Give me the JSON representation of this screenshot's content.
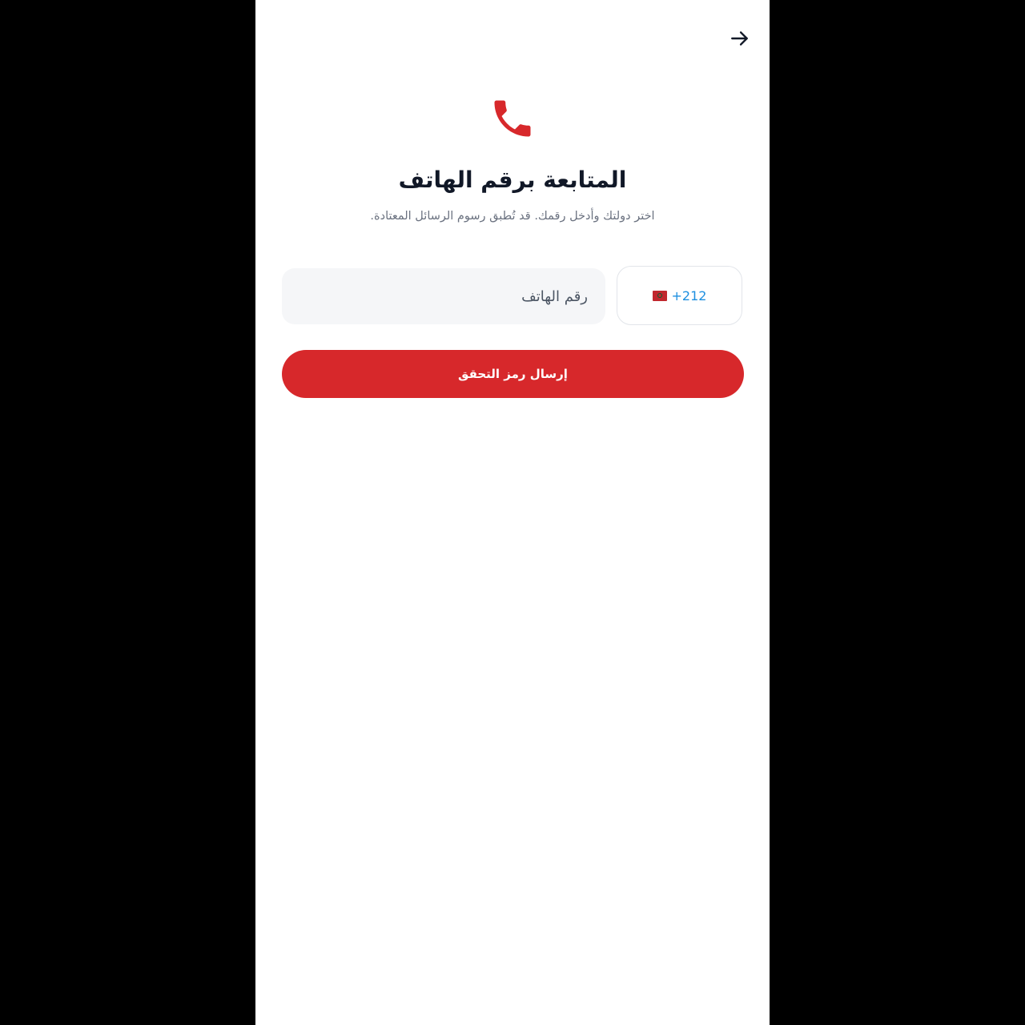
{
  "header": {
    "back_icon": "arrow-right-icon"
  },
  "hero": {
    "icon": "phone-icon",
    "icon_color": "#d7282b",
    "title": "المتابعة برقم الهاتف",
    "subtitle": "اختر دولتك وأدخل رقمك. قد تُطبق رسوم الرسائل المعتادة."
  },
  "form": {
    "country": {
      "flag_icon": "morocco-flag-icon",
      "dial_code": "+212"
    },
    "phone": {
      "value": "",
      "placeholder": "رقم الهاتف"
    },
    "submit_label": "إرسال رمز التحقق"
  },
  "colors": {
    "accent": "#d7282b",
    "dial_code": "#1d8fe0",
    "title": "#111827",
    "subtitle": "#6b7280"
  }
}
